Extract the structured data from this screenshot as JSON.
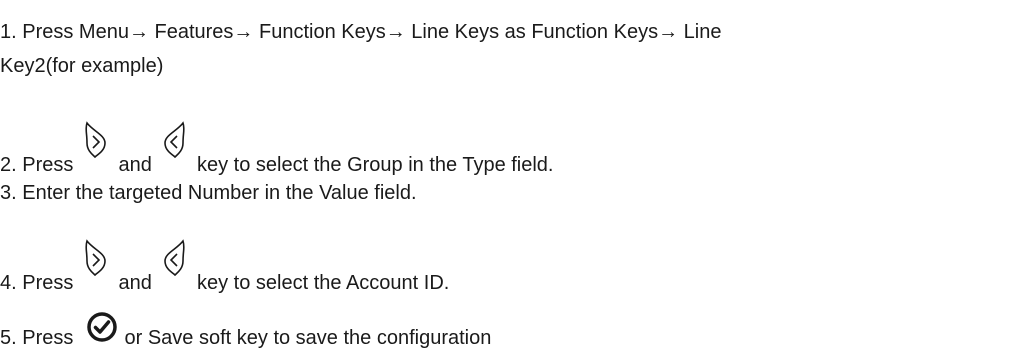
{
  "steps": {
    "step1": {
      "line1": "1. Press Menu→ Features→ Function Keys→ Line Keys as Function Keys→ Line",
      "line2": "Key2(for example)"
    },
    "step2": {
      "prefix": "2. Press",
      "and": "and",
      "suffix": "key to select the Group in the Type field."
    },
    "step3": {
      "text": "3. Enter the targeted Number in the Value field."
    },
    "step4": {
      "prefix": "4. Press",
      "and": "and",
      "suffix": "key to select the Account ID."
    },
    "step5": {
      "prefix": "5. Press",
      "suffix": "or Save soft key to save the configuration"
    }
  },
  "icons": {
    "right": "right-navigation-key-icon",
    "left": "left-navigation-key-icon",
    "ok": "ok-key-icon"
  }
}
